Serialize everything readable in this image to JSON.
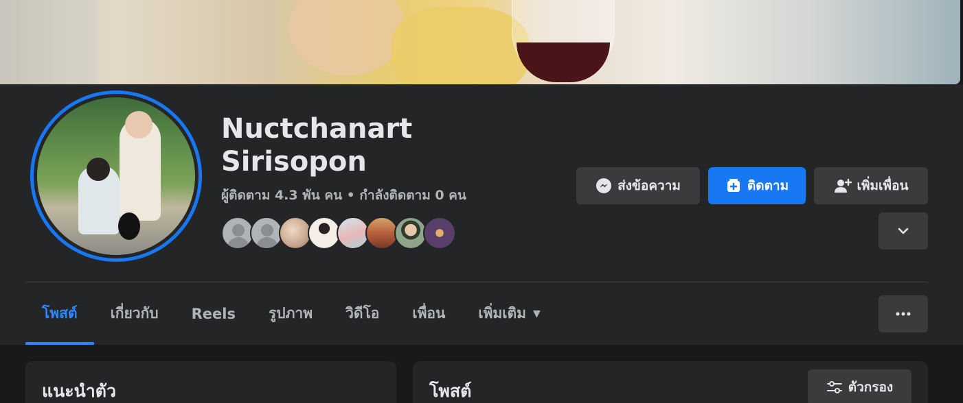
{
  "profile": {
    "name_line1": "Nuctchanart",
    "name_line2": "Sirisopon",
    "followers_text": "ผู้ติดตาม 4.3 พัน คน • กำลังติดตาม 0 คน"
  },
  "actions": {
    "message_label": "ส่งข้อความ",
    "follow_label": "ติดตาม",
    "add_friend_label": "เพิ่มเพื่อน",
    "more_icon": "chevron-down-icon"
  },
  "tabs": [
    {
      "label": "โพสต์",
      "active": true
    },
    {
      "label": "เกี่ยวกับ",
      "active": false
    },
    {
      "label": "Reels",
      "active": false
    },
    {
      "label": "รูปภาพ",
      "active": false
    },
    {
      "label": "วิดีโอ",
      "active": false
    },
    {
      "label": "เพื่อน",
      "active": false
    },
    {
      "label": "เพิ่มเติม",
      "active": false
    }
  ],
  "tabs_more_icon": "ellipsis-icon",
  "intro": {
    "title": "แนะนำตัว"
  },
  "posts": {
    "title": "โพสต์",
    "filter_label": "ตัวกรอง"
  },
  "colors": {
    "accent": "#1877f2",
    "active_tab": "#2d88ff",
    "panel": "#242526",
    "background": "#18191a",
    "button": "#3a3b3c"
  }
}
